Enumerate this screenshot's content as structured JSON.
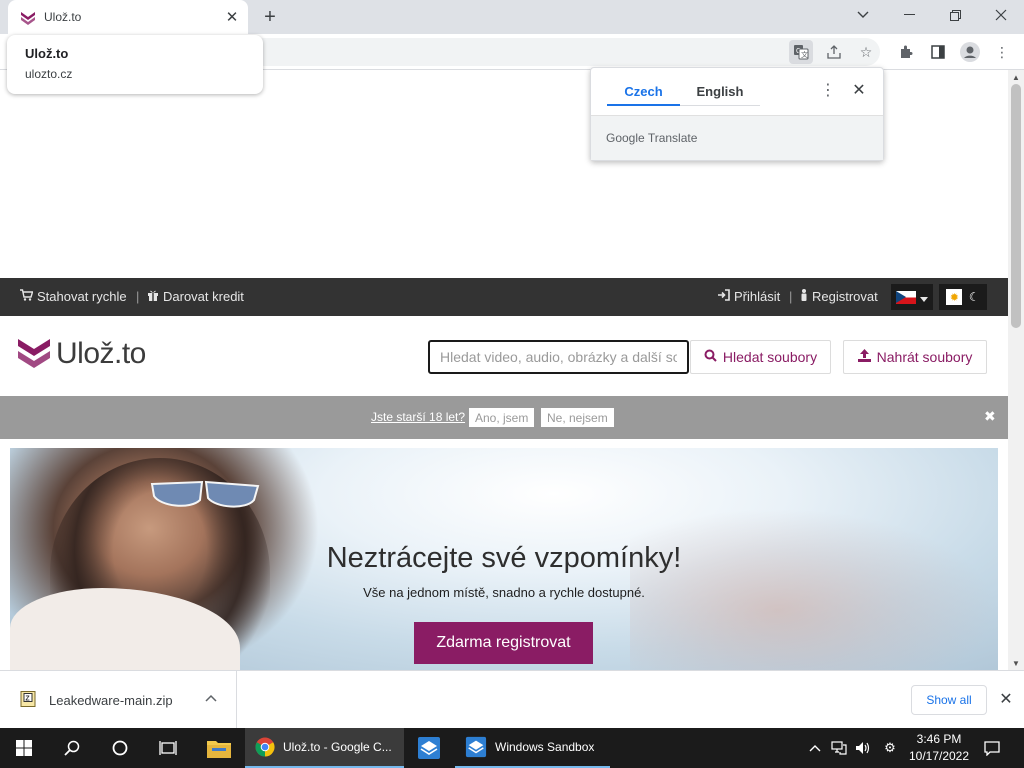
{
  "browser": {
    "tab": {
      "title": "Ulož.to"
    },
    "hovercard": {
      "title": "Ulož.to",
      "url": "ulozto.cz"
    }
  },
  "translate": {
    "lang_source": "Czech",
    "lang_target": "English",
    "footer": "Google Translate"
  },
  "site": {
    "topbar": {
      "fast_download": "Stahovat rychle",
      "donate_credit": "Darovat kredit",
      "login": "Přihlásit",
      "register": "Registrovat"
    },
    "logo_text": "Ulož.to",
    "search": {
      "placeholder": "Hledat video, audio, obrázky a další soubory",
      "value": ""
    },
    "search_button": "Hledat soubory",
    "upload_button": "Nahrát soubory",
    "age_check": {
      "question": "Jste starší 18 let?",
      "yes": "Ano, jsem",
      "no": "Ne, nejsem"
    },
    "hero": {
      "title": "Neztrácejte své vzpomínky!",
      "subtitle": "Vše na jednom místě, snadno a rychle dostupné.",
      "cta": "Zdarma registrovat"
    },
    "brand_color": "#8a1c64"
  },
  "downloads": {
    "file_name": "Leakedware-main.zip",
    "show_all": "Show all"
  },
  "taskbar": {
    "chrome_label": "Ulož.to - Google C...",
    "sandbox_label": "Windows Sandbox",
    "time": "3:46 PM",
    "date": "10/17/2022"
  }
}
